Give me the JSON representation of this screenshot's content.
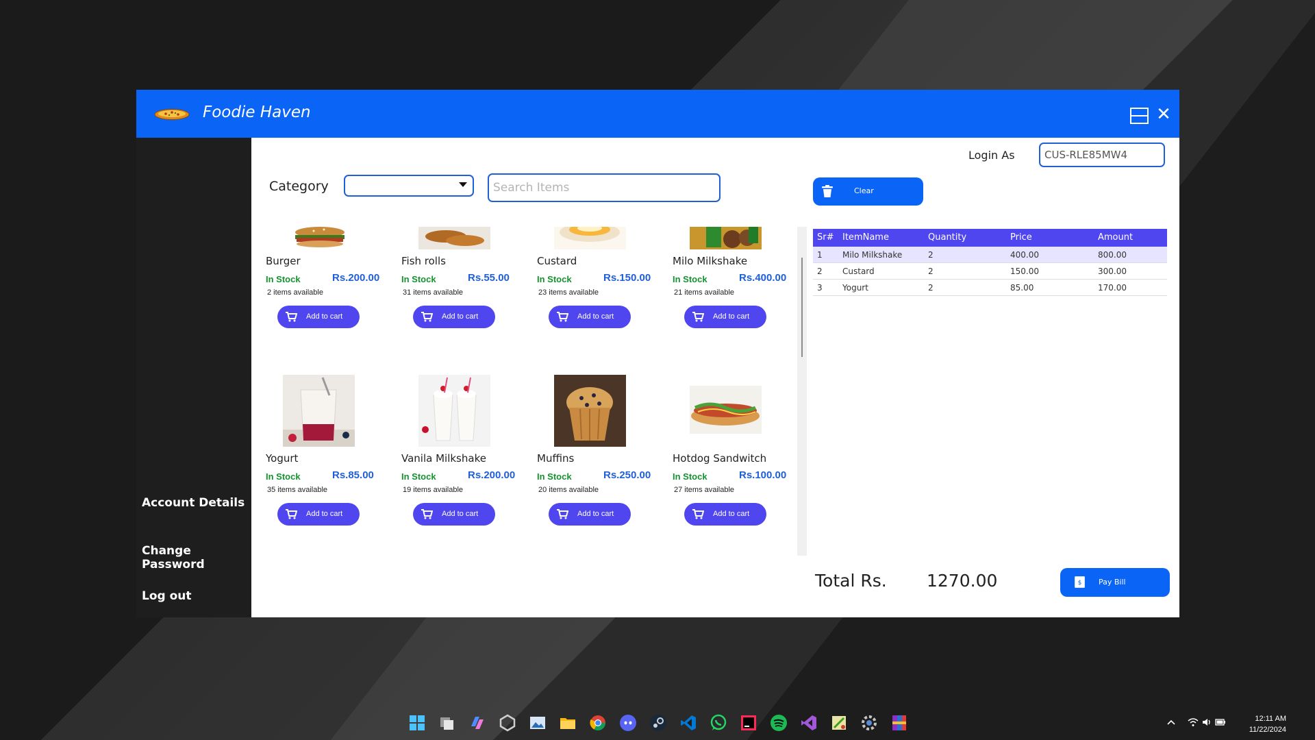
{
  "window": {
    "title": "Foodie Haven",
    "maximize_icon": "maximize-icon",
    "close_icon": "close-icon",
    "close_glyph": "✕"
  },
  "sidebar": {
    "items": [
      {
        "label": "Account Details"
      },
      {
        "label": "Change Password"
      },
      {
        "label": "Log out"
      }
    ]
  },
  "toolbar": {
    "category_label": "Category",
    "category_value": "",
    "search_placeholder": "Search Items",
    "login_label": "Login As",
    "login_value": "CUS-RLE85MW4",
    "clear_label": "Clear",
    "clear_icon": "trash-icon"
  },
  "products": [
    {
      "name": "Burger",
      "stock": "In Stock",
      "price": "Rs.200.00",
      "available": "2 items available",
      "button": "Add to cart",
      "image": "burger-image"
    },
    {
      "name": "Fish rolls",
      "stock": "In Stock",
      "price": "Rs.55.00",
      "available": "31 items available",
      "button": "Add to cart",
      "image": "fish-rolls-image"
    },
    {
      "name": "Custard",
      "stock": "In Stock",
      "price": "Rs.150.00",
      "available": "23 items available",
      "button": "Add to cart",
      "image": "custard-image"
    },
    {
      "name": "Milo Milkshake",
      "stock": "In Stock",
      "price": "Rs.400.00",
      "available": "21 items available",
      "button": "Add to cart",
      "image": "milo-milkshake-image"
    },
    {
      "name": "Yogurt",
      "stock": "In Stock",
      "price": "Rs.85.00",
      "available": "35 items available",
      "button": "Add to cart",
      "image": "yogurt-image"
    },
    {
      "name": "Vanila Milkshake",
      "stock": "In Stock",
      "price": "Rs.200.00",
      "available": "19 items available",
      "button": "Add to cart",
      "image": "vanila-milkshake-image"
    },
    {
      "name": "Muffins",
      "stock": "In Stock",
      "price": "Rs.250.00",
      "available": "20 items available",
      "button": "Add to cart",
      "image": "muffins-image"
    },
    {
      "name": "Hotdog Sandwitch",
      "stock": "In Stock",
      "price": "Rs.100.00",
      "available": "27 items available",
      "button": "Add to cart",
      "image": "hotdog-sandwitch-image"
    }
  ],
  "cart": {
    "columns": [
      "Sr#",
      "ItemName",
      "Quantity",
      "Price",
      "Amount"
    ],
    "rows": [
      {
        "sr": "1",
        "item": "Milo Milkshake",
        "qty": "2",
        "price": "400.00",
        "amount": "800.00",
        "selected": true
      },
      {
        "sr": "2",
        "item": "Custard",
        "qty": "2",
        "price": "150.00",
        "amount": "300.00",
        "selected": false
      },
      {
        "sr": "3",
        "item": "Yogurt",
        "qty": "2",
        "price": "85.00",
        "amount": "170.00",
        "selected": false
      }
    ],
    "total_label": "Total Rs.",
    "total_value": "1270.00",
    "pay_label": "Pay Bill",
    "pay_icon": "bill-icon"
  },
  "taskbar": {
    "apps": [
      "windows-start-icon",
      "task-view-icon",
      "copilot-icon",
      "unity-icon",
      "photos-icon",
      "file-explorer-icon",
      "chrome-icon",
      "discord-icon",
      "steam-icon",
      "vscode-icon",
      "whatsapp-icon",
      "intellij-icon",
      "spotify-icon",
      "visual-studio-icon",
      "notepad-plus-icon",
      "settings-icon",
      "winrar-icon"
    ],
    "time": "12:11 AM",
    "date": "11/22/2024",
    "tray_icons": [
      "chevron-up-icon",
      "wifi-icon",
      "volume-icon",
      "battery-icon"
    ]
  },
  "colors": {
    "titlebar": "#0a64f5",
    "accent": "#5046f0",
    "stock_green": "#14932f",
    "price_blue": "#1f5fd8"
  }
}
